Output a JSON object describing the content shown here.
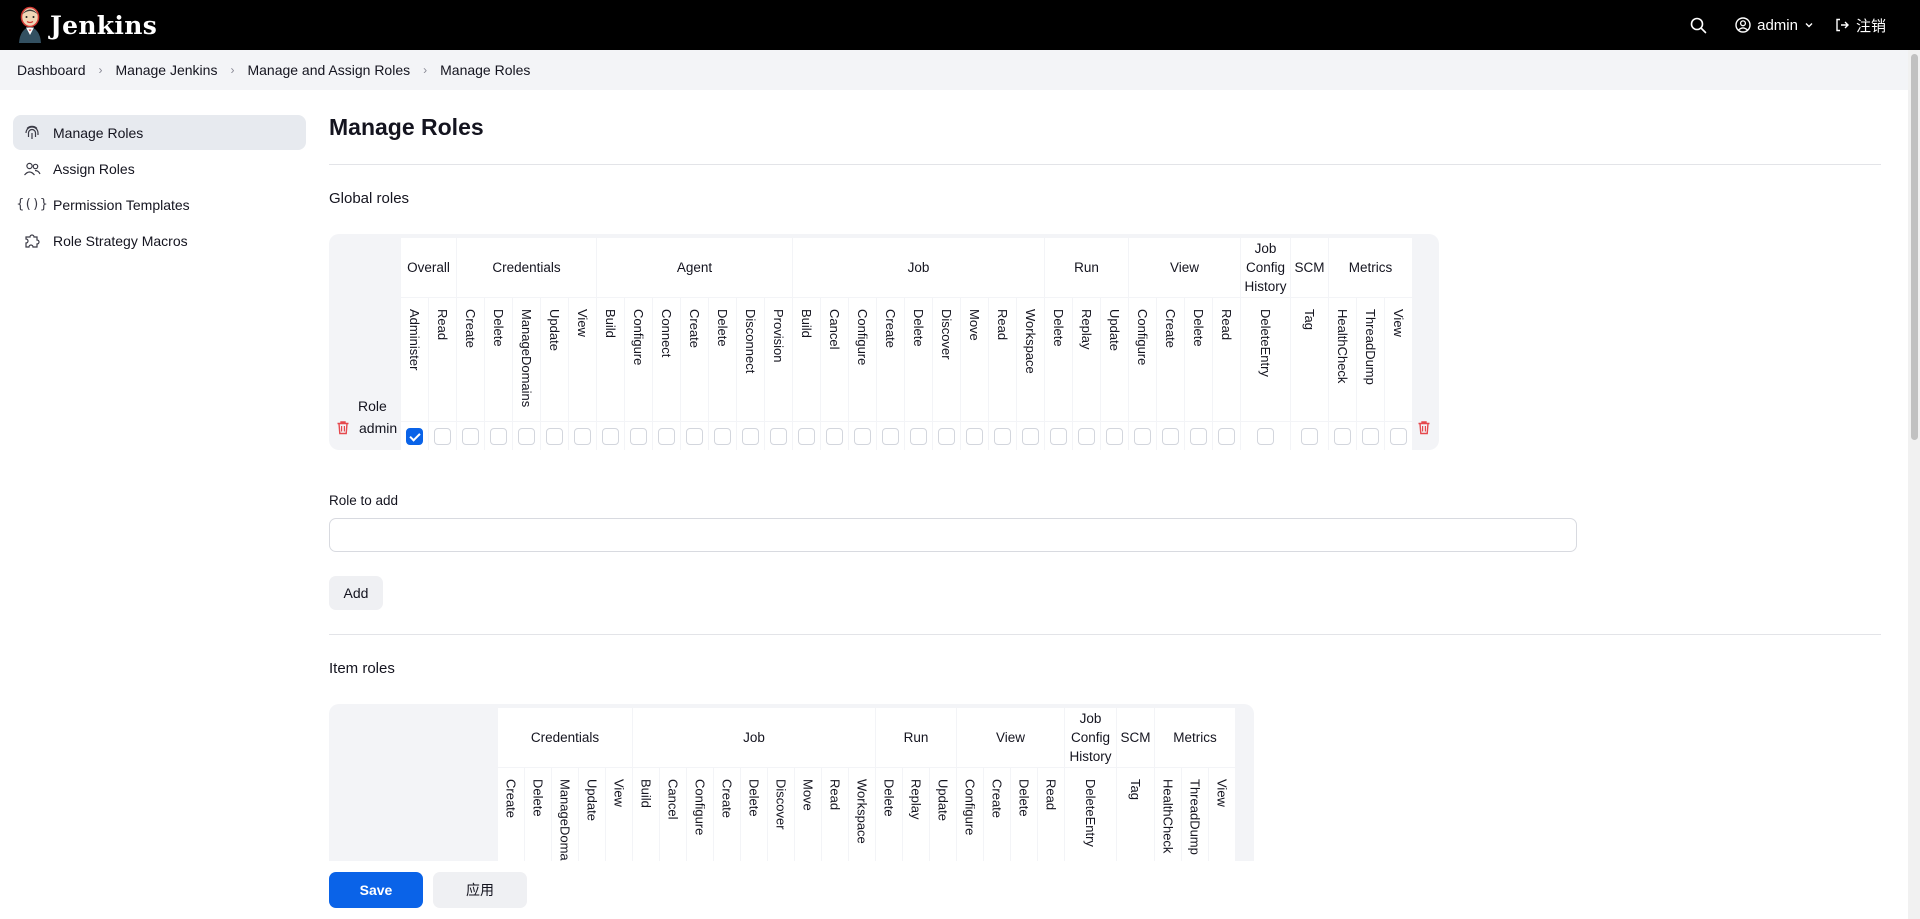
{
  "header": {
    "app_title": "Jenkins",
    "user": "admin",
    "logout_label": "注销",
    "icons": {
      "logo": "jenkins-butler-logo",
      "search": "search-icon",
      "user": "user-circle-icon",
      "chevron": "chevron-down-icon",
      "logout": "logout-icon"
    }
  },
  "breadcrumbs": [
    "Dashboard",
    "Manage Jenkins",
    "Manage and Assign Roles",
    "Manage Roles"
  ],
  "sidebar": {
    "items": [
      {
        "label": "Manage Roles",
        "icon": "fingerprint-icon",
        "active": true
      },
      {
        "label": "Assign Roles",
        "icon": "people-icon",
        "active": false
      },
      {
        "label": "Permission Templates",
        "icon": "braces-icon",
        "active": false
      },
      {
        "label": "Role Strategy Macros",
        "icon": "puzzle-icon",
        "active": false
      }
    ]
  },
  "page": {
    "title": "Manage Roles"
  },
  "global_roles": {
    "section_title": "Global roles",
    "role_column_label": "Role",
    "groups": [
      {
        "label": "Overall",
        "permissions": [
          "Administer",
          "Read"
        ]
      },
      {
        "label": "Credentials",
        "permissions": [
          "Create",
          "Delete",
          "ManageDomains",
          "Update",
          "View"
        ]
      },
      {
        "label": "Agent",
        "permissions": [
          "Build",
          "Configure",
          "Connect",
          "Create",
          "Delete",
          "Disconnect",
          "Provision"
        ]
      },
      {
        "label": "Job",
        "permissions": [
          "Build",
          "Cancel",
          "Configure",
          "Create",
          "Delete",
          "Discover",
          "Move",
          "Read",
          "Workspace"
        ]
      },
      {
        "label": "Run",
        "permissions": [
          "Delete",
          "Replay",
          "Update"
        ]
      },
      {
        "label": "View",
        "permissions": [
          "Configure",
          "Create",
          "Delete",
          "Read"
        ]
      },
      {
        "label": "Job Config History",
        "permissions": [
          "DeleteEntry"
        ]
      },
      {
        "label": "SCM",
        "permissions": [
          "Tag"
        ]
      },
      {
        "label": "Metrics",
        "permissions": [
          "HealthCheck",
          "ThreadDump",
          "View"
        ]
      }
    ],
    "roles": [
      {
        "name": "admin",
        "checked": [
          "Overall/Administer"
        ]
      }
    ]
  },
  "add_role": {
    "label": "Role to add",
    "value": "",
    "button_label": "Add"
  },
  "item_roles": {
    "section_title": "Item roles",
    "groups": [
      {
        "label": "Credentials",
        "permissions": [
          "Create",
          "Delete",
          "ManageDomains",
          "Update",
          "View"
        ]
      },
      {
        "label": "Job",
        "permissions": [
          "Build",
          "Cancel",
          "Configure",
          "Create",
          "Delete",
          "Discover",
          "Move",
          "Read",
          "Workspace"
        ]
      },
      {
        "label": "Run",
        "permissions": [
          "Delete",
          "Replay",
          "Update"
        ]
      },
      {
        "label": "View",
        "permissions": [
          "Configure",
          "Create",
          "Delete",
          "Read"
        ]
      },
      {
        "label": "Job Config History",
        "permissions": [
          "DeleteEntry"
        ]
      },
      {
        "label": "SCM",
        "permissions": [
          "Tag"
        ]
      },
      {
        "label": "Metrics",
        "permissions": [
          "HealthCheck",
          "ThreadDump",
          "View"
        ]
      }
    ]
  },
  "footer": {
    "save_label": "Save",
    "apply_label": "应用"
  },
  "colors": {
    "accent": "#0a63e8",
    "danger": "#e5484d",
    "topbar": "#000000",
    "breadcrumb_bg": "#f3f4f7"
  }
}
